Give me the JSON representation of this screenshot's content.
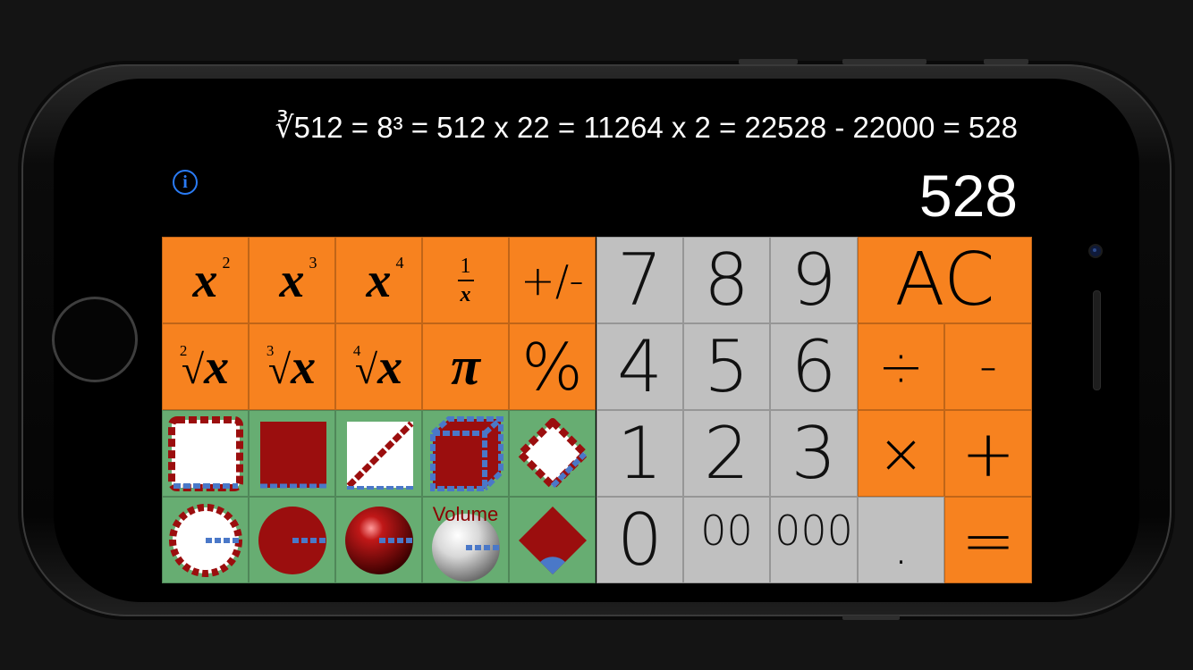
{
  "display": {
    "history": "∛512 = 8³ = 512 x 22 = 11264 x 2 = 22528 - 22000 = 528",
    "result": "528",
    "info_icon": "i"
  },
  "keys": {
    "x_squared": {
      "base": "x",
      "exp": "2"
    },
    "x_cubed": {
      "base": "x",
      "exp": "3"
    },
    "x_fourth": {
      "base": "x",
      "exp": "4"
    },
    "reciprocal": {
      "num": "1",
      "den": "x"
    },
    "plus_minus": "+/-",
    "sqrt": {
      "index": "2",
      "sym": "√",
      "base": "x"
    },
    "cbrt": {
      "index": "3",
      "sym": "√",
      "base": "x"
    },
    "fourth_root": {
      "index": "4",
      "sym": "√",
      "base": "x"
    },
    "pi": "π",
    "percent": "%",
    "digits": {
      "seven": "7",
      "eight": "8",
      "nine": "9",
      "four": "4",
      "five": "5",
      "six": "6",
      "one": "1",
      "two": "2",
      "three": "3",
      "zero": "0",
      "double_zero": "00",
      "triple_zero": "000"
    },
    "decimal": ".",
    "clear": "AC",
    "divide": "÷",
    "subtract": "-",
    "multiply": "×",
    "add": "+",
    "equals": "="
  },
  "geometry_keys": {
    "volume_label": "Volume",
    "icons": [
      "square-perimeter-icon",
      "square-area-icon",
      "square-diagonal-icon",
      "cube-icon",
      "rhombus-perimeter-icon",
      "circle-circumference-icon",
      "circle-area-icon",
      "sphere-icon",
      "sphere-volume-icon",
      "sector-icon"
    ]
  },
  "colors": {
    "orange": "#f7821f",
    "gray": "#c0c0c0",
    "green": "#67ad72",
    "shape_red": "#9b0e0e",
    "dash_blue": "#4a78c8",
    "info_blue": "#2a7bf4"
  }
}
